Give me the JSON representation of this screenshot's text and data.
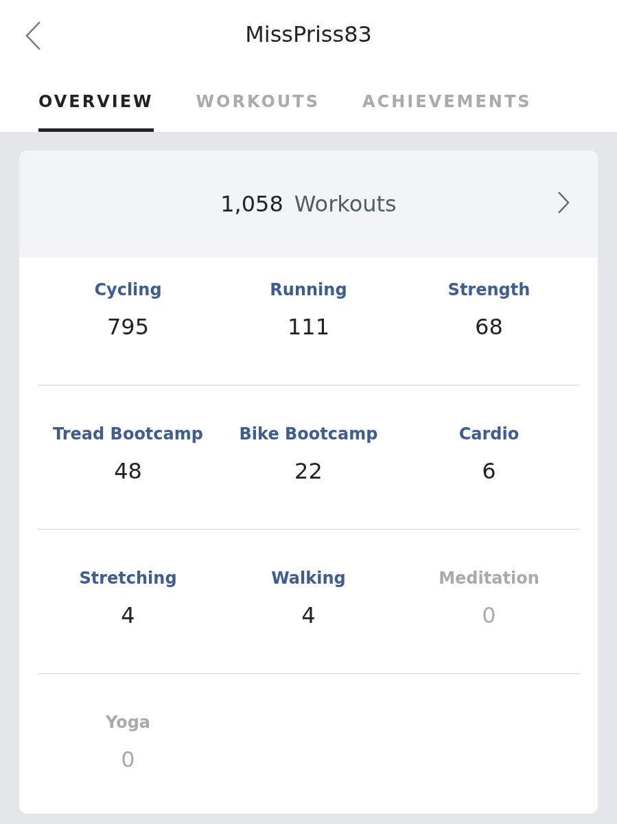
{
  "header": {
    "title": "MissPriss83"
  },
  "tabs": [
    {
      "label": "OVERVIEW",
      "selected": true
    },
    {
      "label": "WORKOUTS",
      "selected": false
    },
    {
      "label": "ACHIEVEMENTS",
      "selected": false
    }
  ],
  "summary": {
    "count": "1,058",
    "label": "Workouts"
  },
  "stats": [
    {
      "label": "Cycling",
      "value": "795",
      "disabled": false
    },
    {
      "label": "Running",
      "value": "111",
      "disabled": false
    },
    {
      "label": "Strength",
      "value": "68",
      "disabled": false
    },
    {
      "label": "Tread Bootcamp",
      "value": "48",
      "disabled": false
    },
    {
      "label": "Bike Bootcamp",
      "value": "22",
      "disabled": false
    },
    {
      "label": "Cardio",
      "value": "6",
      "disabled": false
    },
    {
      "label": "Stretching",
      "value": "4",
      "disabled": false
    },
    {
      "label": "Walking",
      "value": "4",
      "disabled": false
    },
    {
      "label": "Meditation",
      "value": "0",
      "disabled": true
    },
    {
      "label": "Yoga",
      "value": "0",
      "disabled": true
    }
  ]
}
